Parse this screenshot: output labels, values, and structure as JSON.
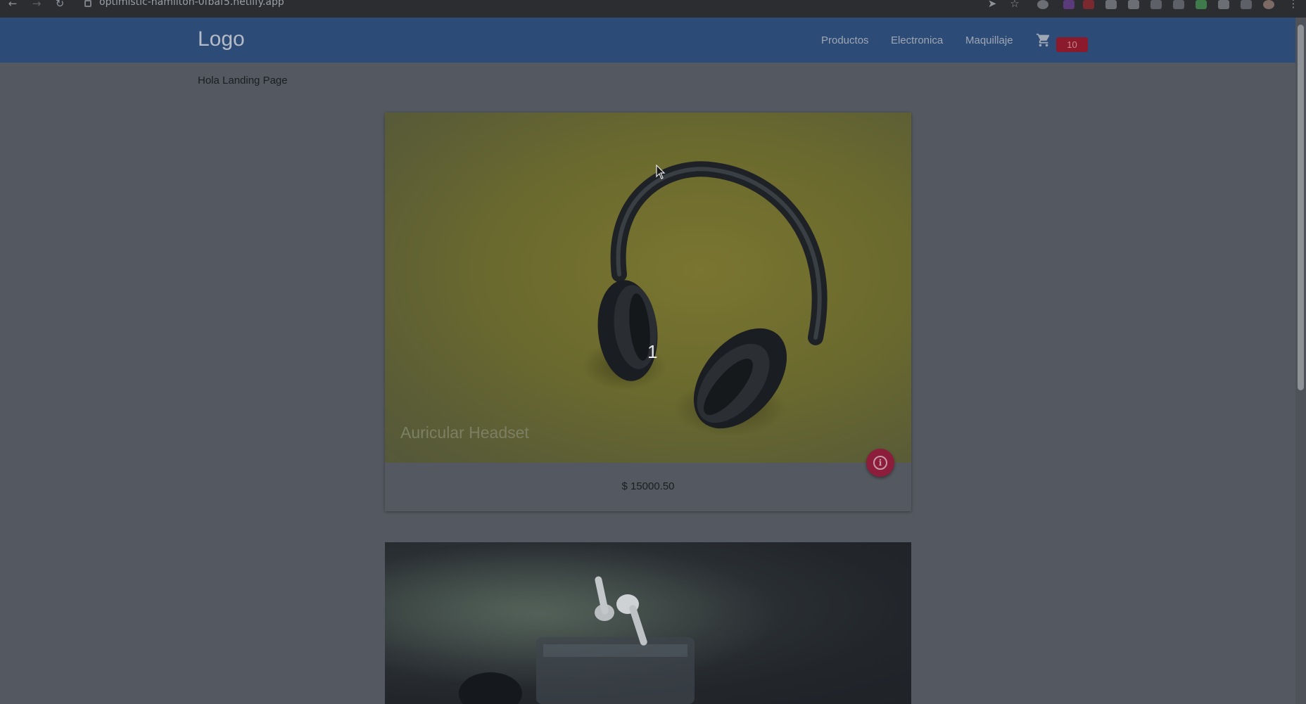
{
  "browser": {
    "url": "optimistic-hamilton-0fbaf5.netlify.app"
  },
  "navbar": {
    "logo": "Logo",
    "links": [
      "Productos",
      "Electronica",
      "Maquillaje"
    ],
    "cart_count": "10"
  },
  "main": {
    "greeting": "Hola Landing Page"
  },
  "products": [
    {
      "slide_number": "1",
      "title": "Auricular Headset",
      "price": "$ 15000.50",
      "image": "headphones-icon"
    },
    {
      "image": "earbuds-icon"
    }
  ],
  "colors": {
    "navbar": "#2c4b76",
    "accent_badge": "#8b1a2d",
    "fab": "#8c1e3c",
    "overlay_background": "#545961"
  }
}
